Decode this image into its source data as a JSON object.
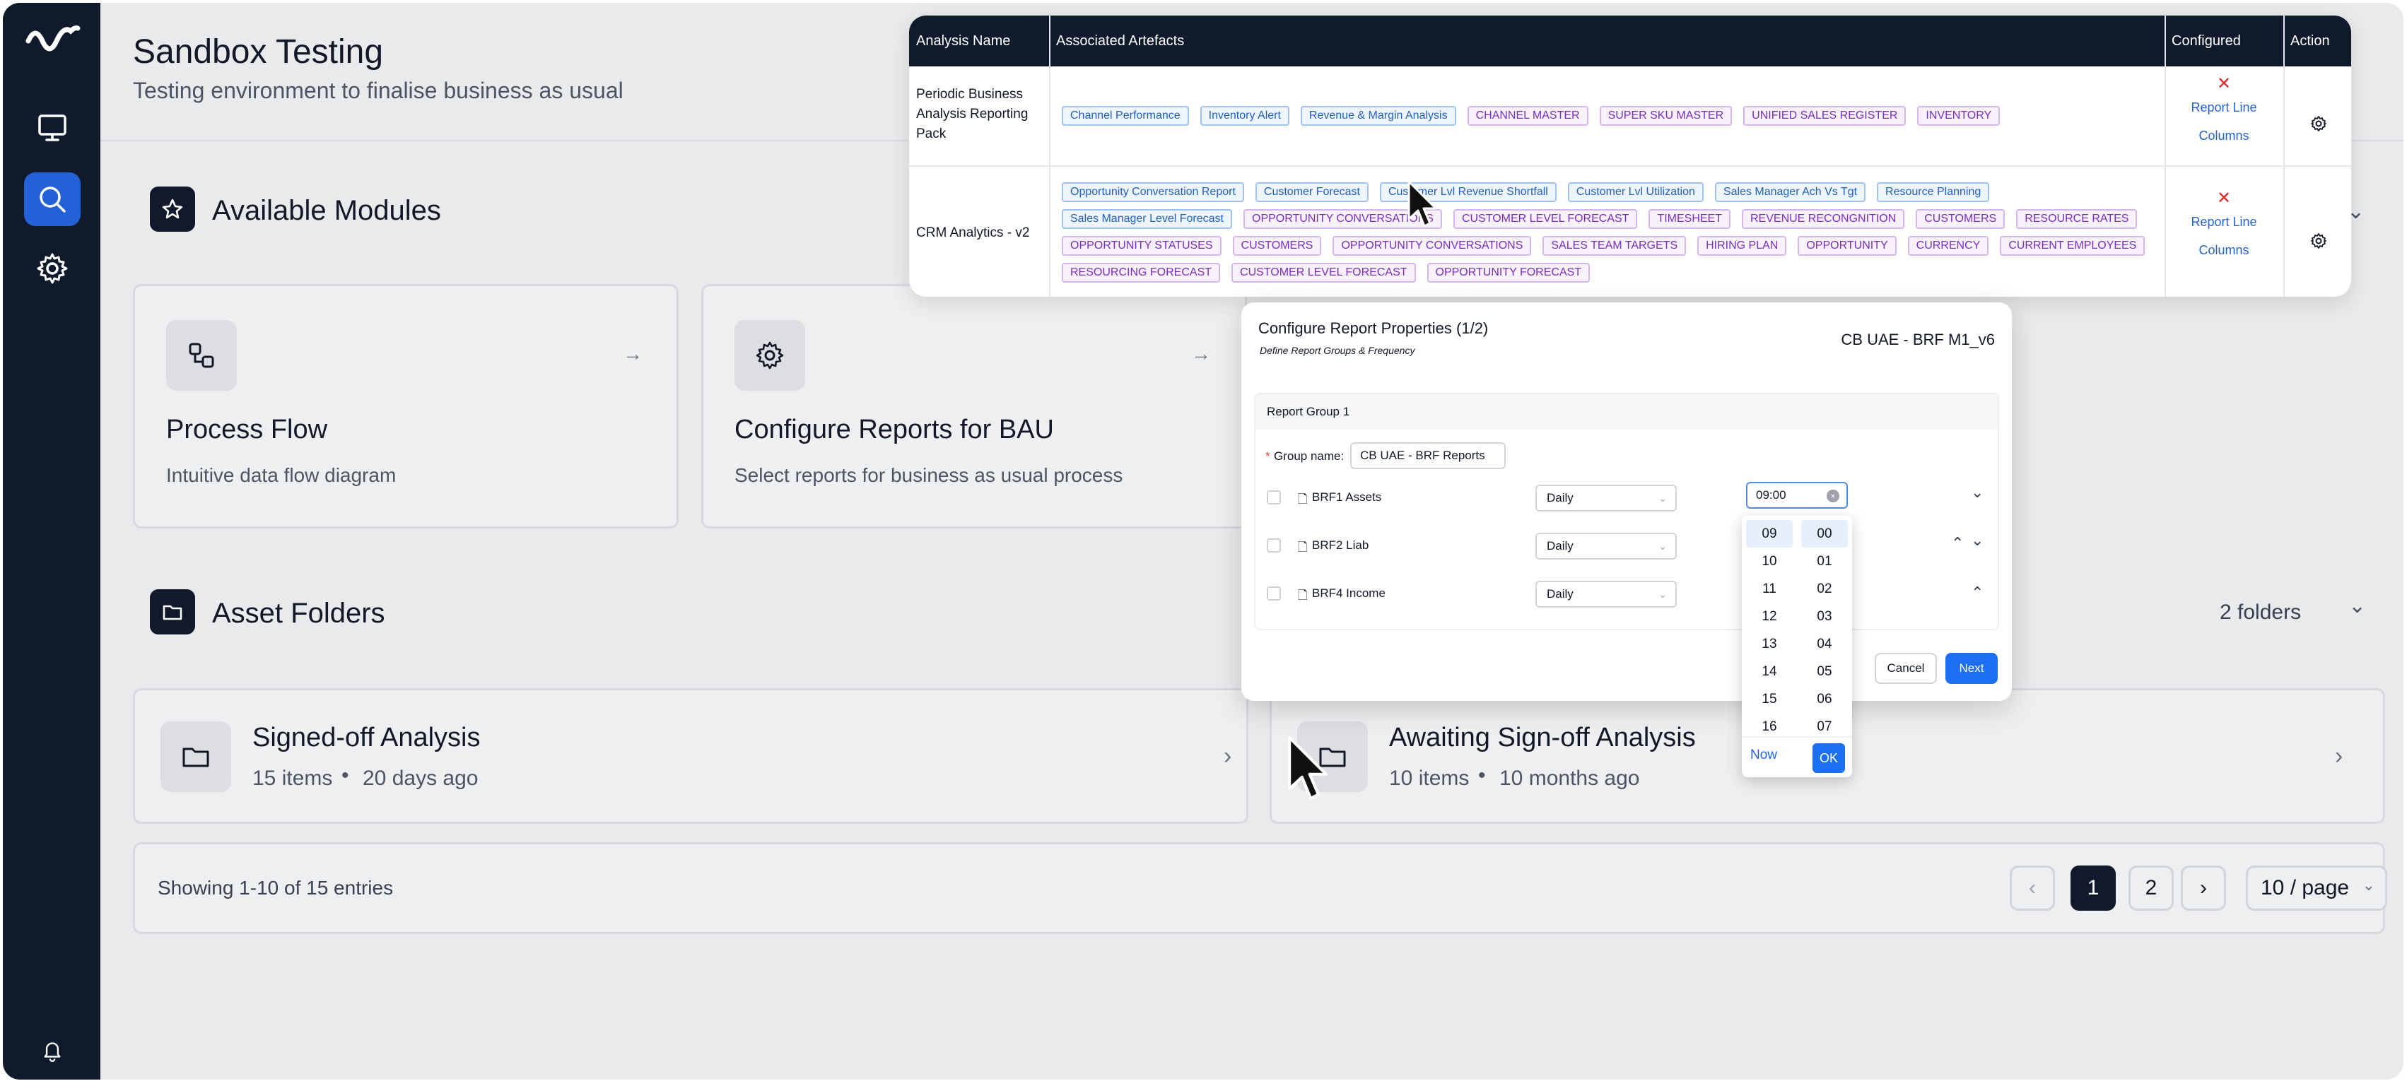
{
  "app": {
    "title": "Sandbox Testing",
    "subtitle": "Testing environment to finalise business as usual"
  },
  "sidebar": {
    "icons": [
      "monitor-icon",
      "search-icon",
      "gear-icon",
      "bell-icon"
    ],
    "active": "search"
  },
  "modules": {
    "title": "Available Modules",
    "cards": [
      {
        "title": "Process Flow",
        "desc": "Intuitive data flow diagram"
      },
      {
        "title": "Configure Reports for BAU",
        "desc": "Select reports for business as usual process"
      }
    ]
  },
  "folders": {
    "title": "Asset Folders",
    "count_label": "2 folders",
    "items": [
      {
        "title": "Signed-off Analysis",
        "count": "15 items",
        "age": "20 days ago"
      },
      {
        "title": "Awaiting Sign-off Analysis",
        "count": "10 items",
        "age": "10 months ago"
      }
    ],
    "showing": "Showing 1-10 of 15 entries",
    "pages": [
      "1",
      "2"
    ],
    "page_size": "10 / page"
  },
  "table": {
    "headers": [
      "Analysis Name",
      "Associated Artefacts",
      "Configured",
      "Action"
    ],
    "rows": [
      {
        "name": "Periodic Business Analysis Reporting Pack",
        "configured": [
          "Report Line",
          "Columns"
        ],
        "tags": [
          {
            "t": "Channel Performance",
            "c": "blue"
          },
          {
            "t": "Inventory Alert",
            "c": "blue"
          },
          {
            "t": "Revenue & Margin Analysis",
            "c": "blue"
          },
          {
            "t": "CHANNEL MASTER",
            "c": "purple"
          },
          {
            "t": "SUPER SKU MASTER",
            "c": "purple"
          },
          {
            "t": "UNIFIED SALES REGISTER",
            "c": "purple"
          },
          {
            "t": "INVENTORY",
            "c": "purple"
          }
        ]
      },
      {
        "name": "CRM Analytics - v2",
        "configured": [
          "Report Line",
          "Columns"
        ],
        "tags": [
          {
            "t": "Opportunity Conversation Report",
            "c": "blue"
          },
          {
            "t": "Customer Forecast",
            "c": "blue"
          },
          {
            "t": "Customer Lvl Revenue Shortfall",
            "c": "blue"
          },
          {
            "t": "Customer Lvl Utilization",
            "c": "blue"
          },
          {
            "t": "Sales Manager Ach Vs Tgt",
            "c": "blue"
          },
          {
            "t": "Resource Planning",
            "c": "blue"
          },
          {
            "t": "Sales Manager Level Forecast",
            "c": "blue"
          },
          {
            "t": "OPPORTUNITY CONVERSATIONS",
            "c": "purple"
          },
          {
            "t": "CUSTOMER LEVEL FORECAST",
            "c": "purple"
          },
          {
            "t": "TIMESHEET",
            "c": "purple"
          },
          {
            "t": "REVENUE RECONGNITION",
            "c": "purple"
          },
          {
            "t": "CUSTOMERS",
            "c": "purple"
          },
          {
            "t": "RESOURCE RATES",
            "c": "purple"
          },
          {
            "t": "OPPORTUNITY STATUSES",
            "c": "purple"
          },
          {
            "t": "CUSTOMERS",
            "c": "purple"
          },
          {
            "t": "OPPORTUNITY CONVERSATIONS",
            "c": "purple"
          },
          {
            "t": "SALES TEAM TARGETS",
            "c": "purple"
          },
          {
            "t": "HIRING PLAN",
            "c": "purple"
          },
          {
            "t": "OPPORTUNITY",
            "c": "purple"
          },
          {
            "t": "CURRENCY",
            "c": "purple"
          },
          {
            "t": "CURRENT EMPLOYEES",
            "c": "purple"
          },
          {
            "t": "RESOURCING FORECAST",
            "c": "purple"
          },
          {
            "t": "CUSTOMER LEVEL FORECAST",
            "c": "purple"
          },
          {
            "t": "OPPORTUNITY FORECAST",
            "c": "purple"
          }
        ]
      }
    ]
  },
  "dialog": {
    "title": "Configure Report Properties (1/2)",
    "subtitle": "Define Report Groups & Frequency",
    "report_name": "CB UAE - BRF M1_v6",
    "group_header": "Report Group 1",
    "group_label": "Group name:",
    "group_required": "*",
    "group_value": "CB UAE - BRF Reports",
    "reports": [
      {
        "name": "BRF1 Assets",
        "freq": "Daily"
      },
      {
        "name": "BRF2 Liab",
        "freq": "Daily"
      },
      {
        "name": "BRF4 Income",
        "freq": "Daily"
      }
    ],
    "time_value": "09:00",
    "cancel": "Cancel",
    "next": "Next"
  },
  "time_picker": {
    "hours": [
      "09",
      "10",
      "11",
      "12",
      "13",
      "14",
      "15",
      "16"
    ],
    "minutes": [
      "00",
      "01",
      "02",
      "03",
      "04",
      "05",
      "06",
      "07"
    ],
    "selected_hour": "09",
    "selected_minute": "00",
    "now": "Now",
    "ok": "OK"
  },
  "colors": {
    "sidebar": "#0f1a2c",
    "accent": "#2460d6",
    "primary_button": "#1d6ff2",
    "tag_blue": "#2160c4",
    "tag_purple": "#7b2cbf",
    "danger": "#dc2626"
  }
}
